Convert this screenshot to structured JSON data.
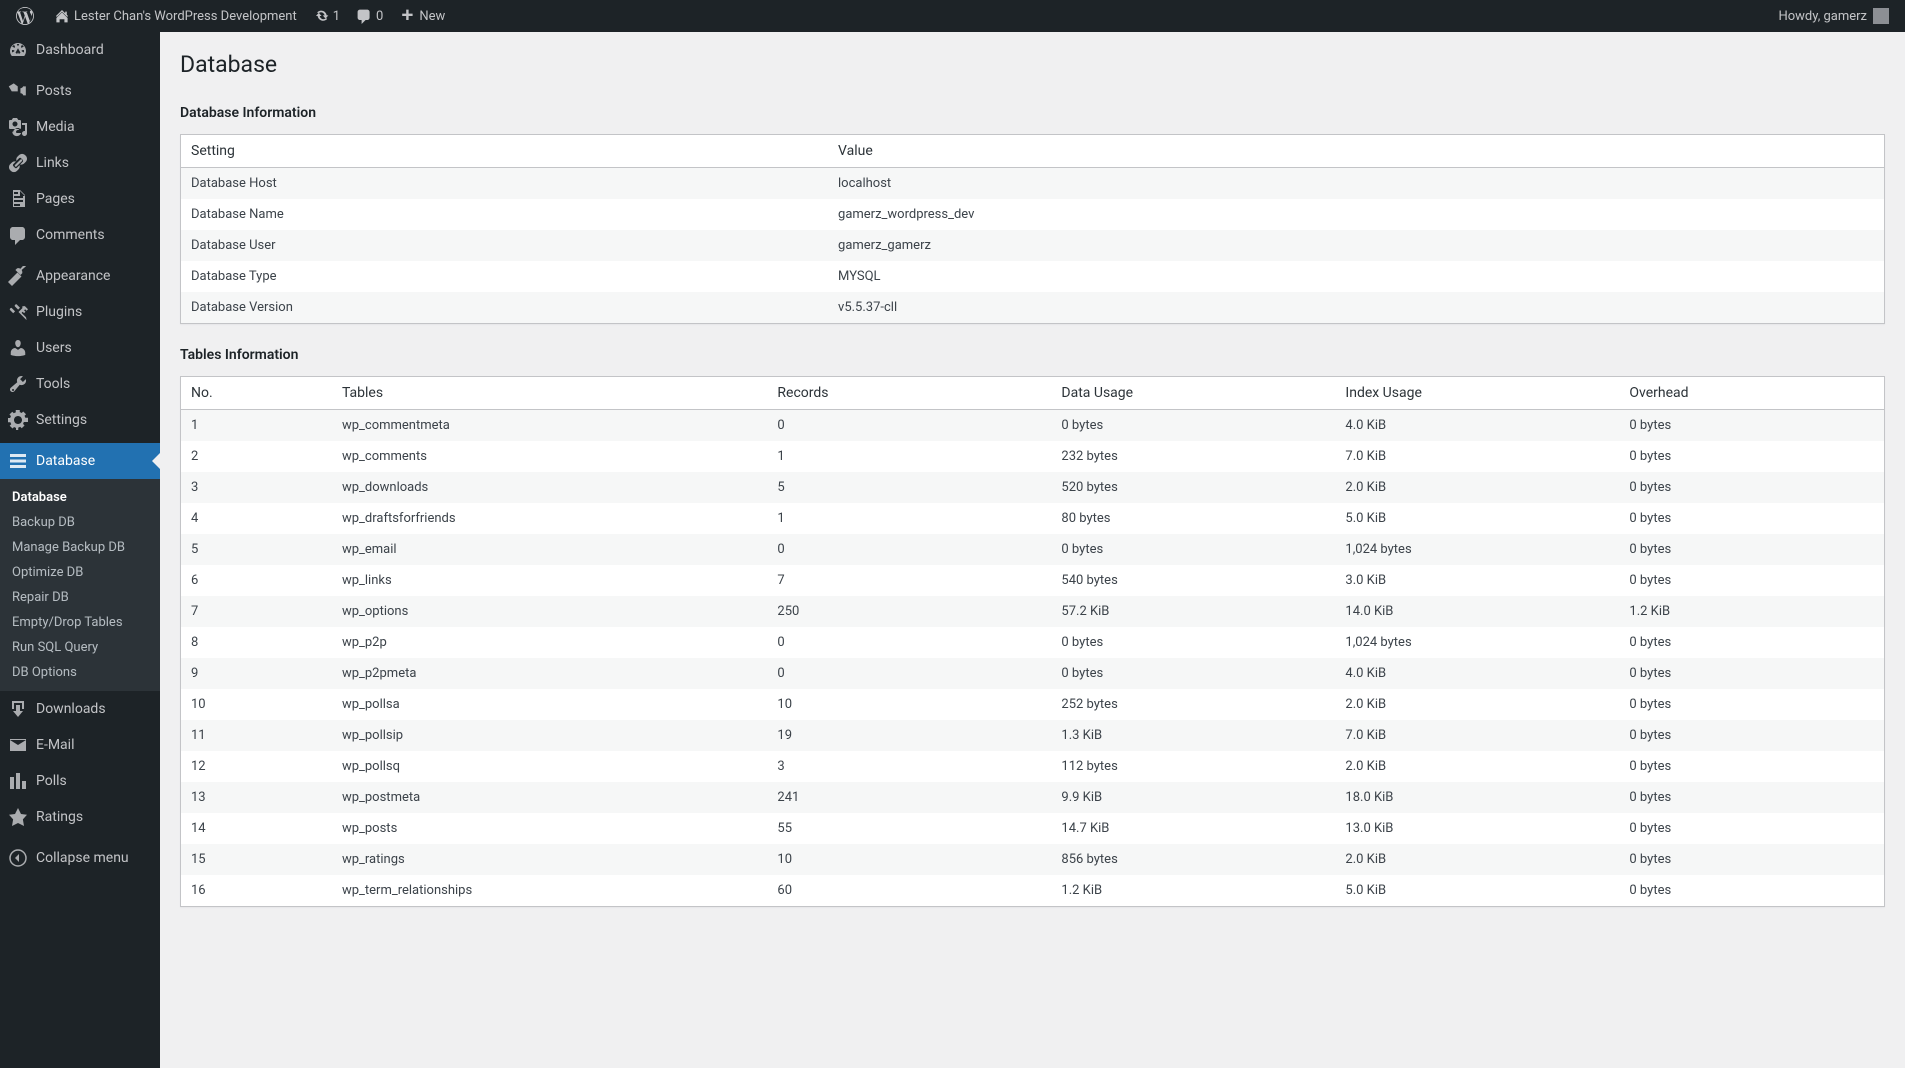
{
  "adminbar": {
    "site_name": "Lester Chan's WordPress Development",
    "updates_count": "1",
    "comments_count": "0",
    "new_label": "New",
    "howdy": "Howdy, gamerz"
  },
  "sidebar": {
    "items": [
      {
        "icon": "dashboard",
        "label": "Dashboard"
      },
      {
        "sep": true
      },
      {
        "icon": "pin",
        "label": "Posts"
      },
      {
        "icon": "media",
        "label": "Media"
      },
      {
        "icon": "link",
        "label": "Links"
      },
      {
        "icon": "page",
        "label": "Pages"
      },
      {
        "icon": "comment",
        "label": "Comments"
      },
      {
        "sep": true
      },
      {
        "icon": "appearance",
        "label": "Appearance"
      },
      {
        "icon": "plugin",
        "label": "Plugins"
      },
      {
        "icon": "users",
        "label": "Users"
      },
      {
        "icon": "tools",
        "label": "Tools"
      },
      {
        "icon": "settings",
        "label": "Settings"
      },
      {
        "sep": true
      },
      {
        "icon": "database",
        "label": "Database",
        "current": true,
        "submenu": [
          "Database",
          "Backup DB",
          "Manage Backup DB",
          "Optimize DB",
          "Repair DB",
          "Empty/Drop Tables",
          "Run SQL Query",
          "DB Options"
        ],
        "submenu_current": 0
      },
      {
        "icon": "download",
        "label": "Downloads"
      },
      {
        "icon": "email",
        "label": "E-Mail"
      },
      {
        "icon": "polls",
        "label": "Polls"
      },
      {
        "icon": "star",
        "label": "Ratings"
      },
      {
        "sep": true
      },
      {
        "icon": "collapse",
        "label": "Collapse menu"
      }
    ]
  },
  "page": {
    "title": "Database",
    "section1": "Database Information",
    "section2": "Tables Information"
  },
  "dbinfo": {
    "headers": [
      "Setting",
      "Value"
    ],
    "rows": [
      [
        "Database Host",
        "localhost"
      ],
      [
        "Database Name",
        "gamerz_wordpress_dev"
      ],
      [
        "Database User",
        "gamerz_gamerz"
      ],
      [
        "Database Type",
        "MYSQL"
      ],
      [
        "Database Version",
        "v5.5.37-cll"
      ]
    ]
  },
  "tables": {
    "headers": [
      "No.",
      "Tables",
      "Records",
      "Data Usage",
      "Index Usage",
      "Overhead"
    ],
    "rows": [
      [
        "1",
        "wp_commentmeta",
        "0",
        "0 bytes",
        "4.0 KiB",
        "0 bytes"
      ],
      [
        "2",
        "wp_comments",
        "1",
        "232 bytes",
        "7.0 KiB",
        "0 bytes"
      ],
      [
        "3",
        "wp_downloads",
        "5",
        "520 bytes",
        "2.0 KiB",
        "0 bytes"
      ],
      [
        "4",
        "wp_draftsforfriends",
        "1",
        "80 bytes",
        "5.0 KiB",
        "0 bytes"
      ],
      [
        "5",
        "wp_email",
        "0",
        "0 bytes",
        "1,024 bytes",
        "0 bytes"
      ],
      [
        "6",
        "wp_links",
        "7",
        "540 bytes",
        "3.0 KiB",
        "0 bytes"
      ],
      [
        "7",
        "wp_options",
        "250",
        "57.2 KiB",
        "14.0 KiB",
        "1.2 KiB"
      ],
      [
        "8",
        "wp_p2p",
        "0",
        "0 bytes",
        "1,024 bytes",
        "0 bytes"
      ],
      [
        "9",
        "wp_p2pmeta",
        "0",
        "0 bytes",
        "4.0 KiB",
        "0 bytes"
      ],
      [
        "10",
        "wp_pollsa",
        "10",
        "252 bytes",
        "2.0 KiB",
        "0 bytes"
      ],
      [
        "11",
        "wp_pollsip",
        "19",
        "1.3 KiB",
        "7.0 KiB",
        "0 bytes"
      ],
      [
        "12",
        "wp_pollsq",
        "3",
        "112 bytes",
        "2.0 KiB",
        "0 bytes"
      ],
      [
        "13",
        "wp_postmeta",
        "241",
        "9.9 KiB",
        "18.0 KiB",
        "0 bytes"
      ],
      [
        "14",
        "wp_posts",
        "55",
        "14.7 KiB",
        "13.0 KiB",
        "0 bytes"
      ],
      [
        "15",
        "wp_ratings",
        "10",
        "856 bytes",
        "2.0 KiB",
        "0 bytes"
      ],
      [
        "16",
        "wp_term_relationships",
        "60",
        "1.2 KiB",
        "5.0 KiB",
        "0 bytes"
      ]
    ]
  }
}
